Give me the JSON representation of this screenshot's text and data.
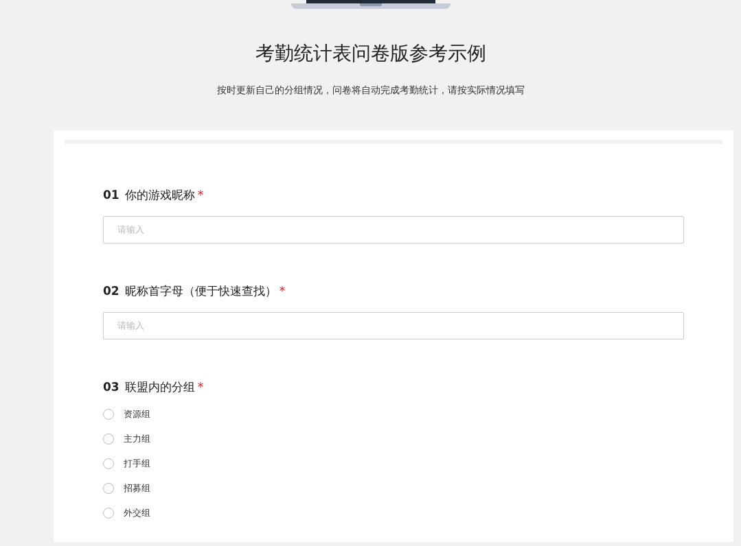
{
  "title": "考勤统计表问卷版参考示例",
  "description": "按时更新自己的分组情况，问卷将自动完成考勤统计，请按实际情况填写",
  "questions": [
    {
      "kind": "text",
      "number": "01",
      "label": "你的游戏昵称",
      "required_mark": "*",
      "placeholder": "请输入"
    },
    {
      "kind": "text",
      "number": "02",
      "label": "昵称首字母（便于快速查找）",
      "required_mark": "*",
      "placeholder": "请输入"
    },
    {
      "kind": "radio",
      "number": "03",
      "label": "联盟内的分组",
      "required_mark": "*",
      "options": [
        {
          "label": "资源组",
          "selected": false
        },
        {
          "label": "主力组",
          "selected": false
        },
        {
          "label": "打手组",
          "selected": false
        },
        {
          "label": "招募组",
          "selected": false
        },
        {
          "label": "外交组",
          "selected": false
        }
      ]
    }
  ]
}
